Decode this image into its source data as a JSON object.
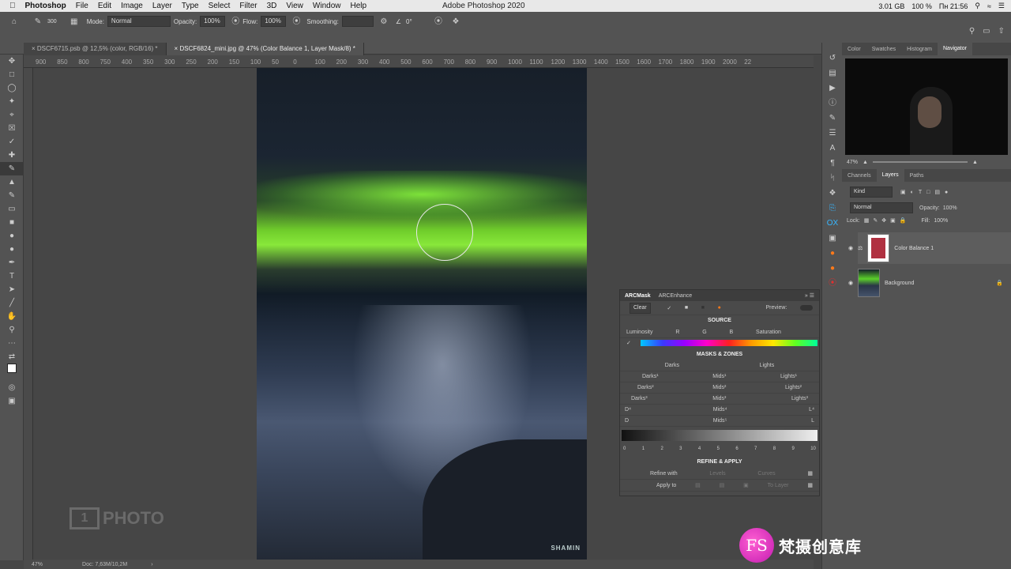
{
  "menubar": {
    "app": "Photoshop",
    "items": [
      "File",
      "Edit",
      "Image",
      "Layer",
      "Type",
      "Select",
      "Filter",
      "3D",
      "View",
      "Window",
      "Help"
    ],
    "window_title": "Adobe Photoshop 2020",
    "status_right": [
      "3.01 GB",
      "100 %",
      "Пн 21:56"
    ]
  },
  "options": {
    "brush_size": "300",
    "mode_label": "Mode:",
    "mode_value": "Normal",
    "opacity_label": "Opacity:",
    "opacity_value": "100%",
    "flow_label": "Flow:",
    "flow_value": "100%",
    "smoothing_label": "Smoothing:",
    "angle_value": "0°"
  },
  "tabs": [
    "DSCF6715.psb @ 12,5% (color, RGB/16) *",
    "DSCF6824_mini.jpg @ 47% (Color Balance 1, Layer Mask/8) *"
  ],
  "ruler": [
    "900",
    "850",
    "800",
    "750",
    "400",
    "350",
    "300",
    "250",
    "200",
    "150",
    "100",
    "50",
    "0",
    "100",
    "200",
    "300",
    "400",
    "500",
    "600",
    "700",
    "800",
    "900",
    "1000",
    "1100",
    "1200",
    "1300",
    "1400",
    "1500",
    "1600",
    "1700",
    "1800",
    "1900",
    "2000",
    "22"
  ],
  "canvas": {
    "signature": "SHAMIN"
  },
  "watermark": {
    "box": "1",
    "text": "PHOTO"
  },
  "status": {
    "zoom": "47%",
    "doc": "Doc: 7,63M/10,2M"
  },
  "right_panel": {
    "top_tabs": [
      "Color",
      "Swatches",
      "Histogram",
      "Navigator"
    ],
    "nav_zoom": "47%",
    "layer_tabs": [
      "Channels",
      "Layers",
      "Paths"
    ],
    "kind_label": "Kind",
    "blend_mode": "Normal",
    "opacity_label": "Opacity:",
    "opacity_value": "100%",
    "lock_label": "Lock:",
    "fill_label": "Fill:",
    "fill_value": "100%",
    "layers": [
      "Color Balance 1",
      "Background"
    ]
  },
  "arc": {
    "tabs": [
      "ARCMask",
      "ARCEnhance"
    ],
    "clear": "Clear",
    "preview": "Preview:",
    "source_title": "SOURCE",
    "source_cols": [
      "Luminosity",
      "R",
      "G",
      "B",
      "Saturation"
    ],
    "masks_title": "MASKS & ZONES",
    "zone_rows": [
      [
        "Darks",
        "Lights"
      ],
      [
        "Darks¹",
        "Mids¹",
        "Lights¹"
      ],
      [
        "Darks²",
        "Mids²",
        "Lights²"
      ],
      [
        "Darks³",
        "Mids³",
        "Lights³"
      ],
      [
        "D⁴",
        "Mids⁴",
        "L⁴"
      ],
      [
        "D",
        "Mids⁵",
        "L"
      ]
    ],
    "numbers": [
      "0",
      "1",
      "2",
      "3",
      "4",
      "5",
      "6",
      "7",
      "8",
      "9",
      "10"
    ],
    "refine_title": "REFINE & APPLY",
    "refine_with": "Refine with",
    "levels": "Levels",
    "curves": "Curves",
    "apply_to": "Apply to",
    "to_layer": "To Layer"
  },
  "fs_logo": {
    "mark": "FS",
    "text": "梵摄创意库"
  }
}
